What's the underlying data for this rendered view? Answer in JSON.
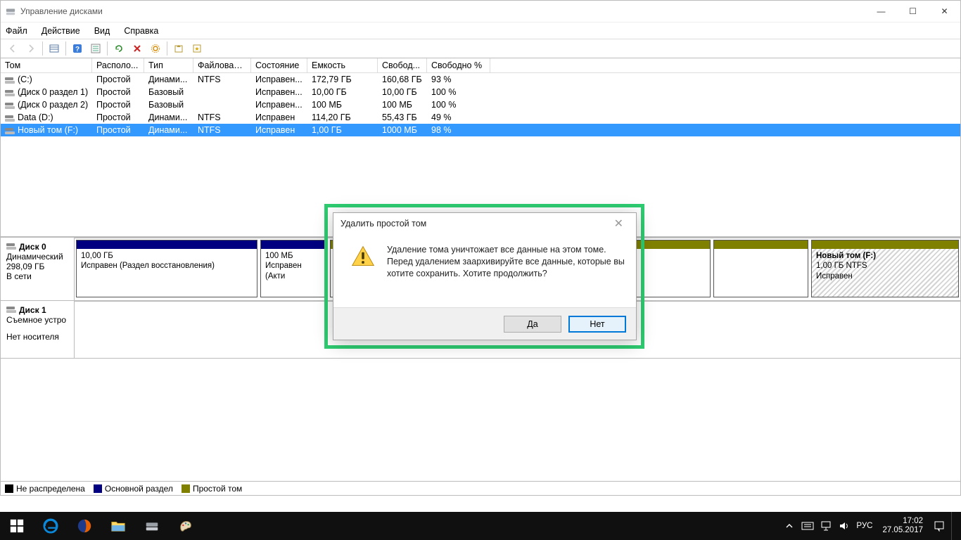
{
  "window": {
    "title": "Управление дисками",
    "menu": {
      "file": "Файл",
      "action": "Действие",
      "view": "Вид",
      "help": "Справка"
    },
    "minimize": "—",
    "maximize": "☐",
    "close": "✕"
  },
  "table": {
    "headers": {
      "volume": "Том",
      "layout": "Располо...",
      "type": "Тип",
      "fs": "Файловая с...",
      "status": "Состояние",
      "capacity": "Емкость",
      "free": "Свобод...",
      "pct": "Свободно %"
    },
    "rows": [
      {
        "volume": "(C:)",
        "layout": "Простой",
        "type": "Динами...",
        "fs": "NTFS",
        "status": "Исправен...",
        "capacity": "172,79 ГБ",
        "free": "160,68 ГБ",
        "pct": "93 %",
        "selected": false
      },
      {
        "volume": "(Диск 0 раздел 1)",
        "layout": "Простой",
        "type": "Базовый",
        "fs": "",
        "status": "Исправен...",
        "capacity": "10,00 ГБ",
        "free": "10,00 ГБ",
        "pct": "100 %",
        "selected": false
      },
      {
        "volume": "(Диск 0 раздел 2)",
        "layout": "Простой",
        "type": "Базовый",
        "fs": "",
        "status": "Исправен...",
        "capacity": "100 МБ",
        "free": "100 МБ",
        "pct": "100 %",
        "selected": false
      },
      {
        "volume": "Data (D:)",
        "layout": "Простой",
        "type": "Динами...",
        "fs": "NTFS",
        "status": "Исправен",
        "capacity": "114,20 ГБ",
        "free": "55,43 ГБ",
        "pct": "49 %",
        "selected": false
      },
      {
        "volume": "Новый том (F:)",
        "layout": "Простой",
        "type": "Динами...",
        "fs": "NTFS",
        "status": "Исправен",
        "capacity": "1,00 ГБ",
        "free": "1000 МБ",
        "pct": "98 %",
        "selected": true
      }
    ]
  },
  "disks": {
    "disk0": {
      "name": "Диск 0",
      "type": "Динамический",
      "size": "298,09 ГБ",
      "state": "В сети"
    },
    "disk1": {
      "name": "Диск 1",
      "type": "Съемное устро",
      "nomedia": "Нет носителя"
    }
  },
  "parts": {
    "p1": {
      "name": "",
      "size": "10,00 ГБ",
      "status": "Исправен (Раздел восстановления)"
    },
    "p2": {
      "name": "",
      "size": "100 МБ",
      "status": "Исправен (Акти"
    },
    "p3": {
      "name": "Новый том  (F:)",
      "size": "1,00 ГБ NTFS",
      "status": "Исправен"
    }
  },
  "legend": {
    "unalloc": "Не распределена",
    "primary": "Основной раздел",
    "simple": "Простой том"
  },
  "dialog": {
    "title": "Удалить простой том",
    "message": "Удаление тома уничтожает все данные на этом томе. Перед удалением заархивируйте все данные, которые вы хотите сохранить. Хотите продолжить?",
    "yes": "Да",
    "no": "Нет"
  },
  "taskbar": {
    "lang": "РУС",
    "time": "17:02",
    "date": "27.05.2017"
  }
}
